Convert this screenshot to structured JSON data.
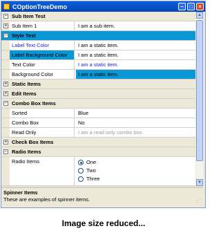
{
  "window": {
    "title": "COptionTreeDemo",
    "buttons": {
      "minimize": "–",
      "maximize": "□",
      "close": "×"
    }
  },
  "scrollbar": {
    "up": "▲",
    "down": "▼"
  },
  "tree": {
    "expand_plus": "+",
    "expand_minus": "−",
    "sub_item_test": "Sub Item Test",
    "sub_item_1": {
      "name": "Sub Item 1",
      "value": "I am a sub item."
    },
    "style_test": "Style Test",
    "label_text_color": {
      "name": "Label Text Color",
      "value": "I am a static item."
    },
    "label_bg_color": {
      "name": "Label Background Color",
      "value": "I am a static item."
    },
    "text_color": {
      "name": "Text Color",
      "value": "I am a static item."
    },
    "bg_color": {
      "name": "Background Color",
      "value": "I am a static item."
    },
    "static_items": "Static Items",
    "edit_items": "Edit Items",
    "combo_box_items": "Combo Box Items",
    "sorted": {
      "name": "Sorted",
      "value": "Blue"
    },
    "combo_box": {
      "name": "Combo Box",
      "value": "No"
    },
    "read_only": {
      "name": "Read Only",
      "value": "I am a read only combo box."
    },
    "check_box_items": "Check Box Items",
    "radio_items": "Radio Items",
    "radio_items_name": "Radio Items",
    "radio_options": [
      "One",
      "Two",
      "Three"
    ],
    "radio_selected": "One"
  },
  "description": {
    "title": "Spinner Items",
    "text": "These are examples of spinner items."
  },
  "caption": "Image size reduced...",
  "colors": {
    "highlight": "#0a97d5",
    "label_text_blue": "#1a1ad8",
    "category_bg": "#ece9d8"
  }
}
